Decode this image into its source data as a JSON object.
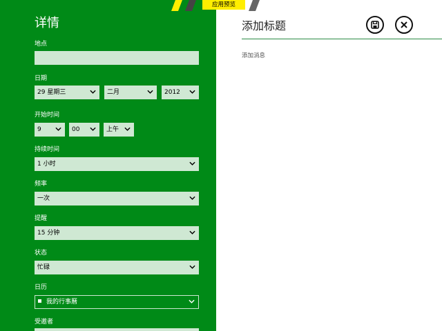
{
  "banner": {
    "label": "应用预览"
  },
  "details": {
    "title": "详情",
    "location": {
      "label": "地点",
      "value": ""
    },
    "date": {
      "label": "日期",
      "day": "29 星期三",
      "month": "二月",
      "year": "2012"
    },
    "start_time": {
      "label": "开始时间",
      "hour": "9",
      "minute": "00",
      "ampm": "上午"
    },
    "duration": {
      "label": "持续时间",
      "value": "1 小时"
    },
    "frequency": {
      "label": "频率",
      "value": "一次"
    },
    "reminder": {
      "label": "提醒",
      "value": "15 分钟"
    },
    "status": {
      "label": "状态",
      "value": "忙碌"
    },
    "calendar": {
      "label": "日历",
      "value": "我的行事曆"
    },
    "invitees": {
      "label": "受邀者"
    }
  },
  "compose": {
    "title": "添加标题",
    "message_placeholder": "添加消息"
  },
  "icons": {
    "save": "save-icon",
    "close": "close-icon"
  },
  "colors": {
    "panel_green": "#008a17",
    "field_bg": "#cfe8d3",
    "banner_yellow": "#ffee00"
  }
}
